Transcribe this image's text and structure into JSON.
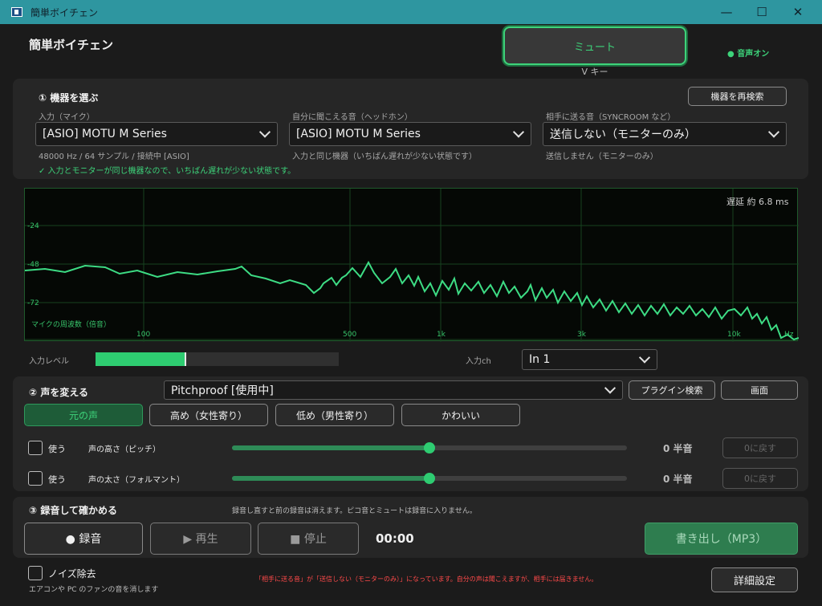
{
  "window": {
    "title": "簡単ボイチェン",
    "controls": {
      "minimize": "—",
      "maximize": "☐",
      "close": "✕"
    }
  },
  "header": {
    "app_title": "簡単ボイチェン",
    "mute_label": "ミュート",
    "mute_hint": "V キー",
    "voice_status": "● 音声オン"
  },
  "devices": {
    "section_title": "① 機器を選ぶ",
    "rescan_label": "機器を再検索",
    "input": {
      "label": "入力（マイク）",
      "value": "[ASIO] MOTU M Series",
      "info": "48000 Hz / 64 サンプル / 接続中 [ASIO]",
      "note": "✓ 入力とモニターが同じ機器なので、いちばん遅れが少ない状態です。"
    },
    "monitor": {
      "label": "自分に聞こえる音（ヘッドホン）",
      "value": "[ASIO] MOTU M Series",
      "info": "入力と同じ機器（いちばん遅れが少ない状態です）"
    },
    "send": {
      "label": "相手に送る音（SYNCROOM など）",
      "value": "送信しない（モニターのみ）",
      "info": "送信しません（モニターのみ）"
    }
  },
  "spectrum": {
    "latency": "遅延 約 6.8 ms",
    "y_ticks": [
      "-24",
      "-48",
      "-72"
    ],
    "x_ticks": [
      "100",
      "500",
      "1k",
      "3k",
      "10k",
      "Hz"
    ],
    "label": "マイクの周波数（倍音）",
    "line_color": "#3ddc84"
  },
  "level": {
    "label": "入力レベル",
    "value_fraction": 0.37,
    "channel_label": "入力ch",
    "channel_value": "In 1"
  },
  "voice": {
    "section_title": "② 声を変える",
    "plugin_value": "Pitchproof  [使用中]",
    "plugin_search_label": "プラグイン検索",
    "screen_label": "画面",
    "presets": [
      "元の声",
      "高め（女性寄り）",
      "低め（男性寄り）",
      "かわいい"
    ],
    "active_preset": 0,
    "pitch": {
      "use_label": "使う",
      "label": "声の高さ（ピッチ）",
      "value": "0 半音",
      "reset_label": "0に戻す",
      "position": 0.5
    },
    "formant": {
      "use_label": "使う",
      "label": "声の太さ（フォルマント）",
      "value": "0 半音",
      "reset_label": "0に戻す",
      "position": 0.5
    }
  },
  "record": {
    "section_title": "③ 録音して確かめる",
    "note": "録音し直すと前の録音は消えます。ピコ音とミュートは録音に入りません。",
    "record_label": "● 録音",
    "play_label": "▶ 再生",
    "stop_label": "■ 停止",
    "time": "00:00",
    "export_label": "書き出し（MP3）"
  },
  "footer": {
    "noise_label": "ノイズ除去",
    "noise_sub": "エアコンや PC のファンの音を消します",
    "warning": "「相手に送る音」が「送信しない（モニターのみ）」になっています。自分の声は聞こえますが、相手には届きません。",
    "advanced_label": "詳細設定"
  }
}
